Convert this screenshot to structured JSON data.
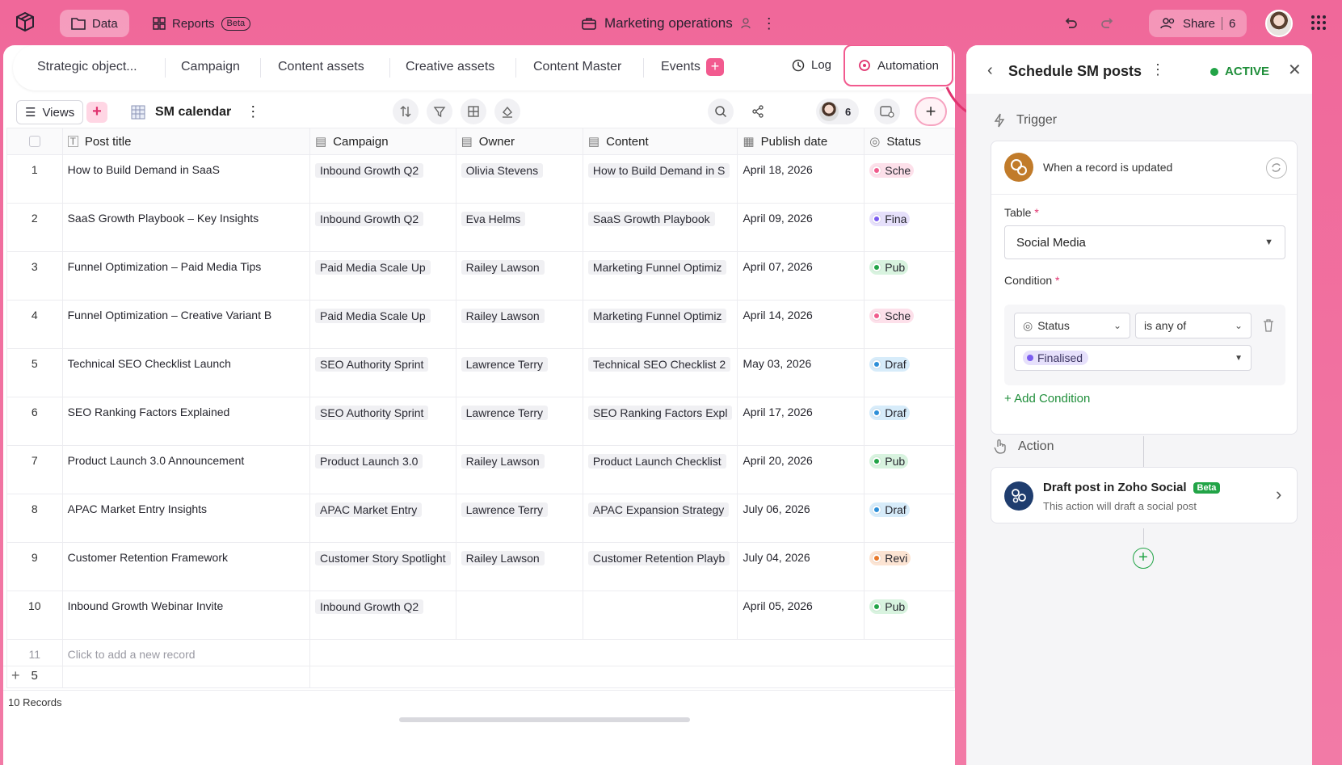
{
  "topbar": {
    "data_label": "Data",
    "reports_label": "Reports",
    "reports_badge": "Beta",
    "workspace_title": "Marketing operations",
    "share_label": "Share",
    "share_count": "6"
  },
  "tabs": {
    "items": [
      "Strategic object...",
      "Campaign",
      "Content assets",
      "Creative assets",
      "Content Master",
      "Events"
    ],
    "log_label": "Log",
    "automation_label": "Automation"
  },
  "toolbar": {
    "views_label": "Views",
    "view_name": "SM calendar",
    "collaborators_count": "6"
  },
  "table": {
    "headers": {
      "post_title": "Post title",
      "campaign": "Campaign",
      "owner": "Owner",
      "content": "Content",
      "publish_date": "Publish date",
      "status": "Status"
    },
    "rows": [
      {
        "num": "1",
        "title": "How to Build Demand in SaaS",
        "campaign": "Inbound Growth Q2",
        "owner": "Olivia Stevens",
        "content": "How to Build Demand in S",
        "date": "April 18, 2026",
        "status": "Sche",
        "status_color": "#f05b8c",
        "status_bg": "#fde0ea"
      },
      {
        "num": "2",
        "title": "SaaS Growth Playbook – Key Insights",
        "campaign": "Inbound Growth Q2",
        "owner": "Eva Helms",
        "content": "SaaS Growth Playbook",
        "date": "April 09, 2026",
        "status": "Fina",
        "status_color": "#7b5cf0",
        "status_bg": "#e6e0fb"
      },
      {
        "num": "3",
        "title": "Funnel Optimization – Paid Media Tips",
        "campaign": "Paid Media Scale Up",
        "owner": "Railey Lawson",
        "content": "Marketing Funnel Optimiz",
        "date": "April 07, 2026",
        "status": "Pub",
        "status_color": "#22a447",
        "status_bg": "#d8f3df"
      },
      {
        "num": "4",
        "title": "Funnel Optimization – Creative Variant B",
        "campaign": "Paid Media Scale Up",
        "owner": "Railey Lawson",
        "content": "Marketing Funnel Optimiz",
        "date": "April 14, 2026",
        "status": "Sche",
        "status_color": "#f05b8c",
        "status_bg": "#fde0ea"
      },
      {
        "num": "5",
        "title": "Technical SEO Checklist Launch",
        "campaign": "SEO Authority Sprint",
        "owner": "Lawrence Terry",
        "content": "Technical SEO Checklist 2",
        "date": "May 03, 2026",
        "status": "Draf",
        "status_color": "#2d8fd8",
        "status_bg": "#d7ecfa"
      },
      {
        "num": "6",
        "title": "SEO Ranking Factors Explained",
        "campaign": "SEO Authority Sprint",
        "owner": "Lawrence Terry",
        "content": "SEO Ranking Factors Expl",
        "date": "April 17, 2026",
        "status": "Draf",
        "status_color": "#2d8fd8",
        "status_bg": "#d7ecfa"
      },
      {
        "num": "7",
        "title": "Product Launch 3.0 Announcement",
        "campaign": "Product Launch 3.0",
        "owner": "Railey Lawson",
        "content": "Product Launch Checklist",
        "date": "April 20, 2026",
        "status": "Pub",
        "status_color": "#22a447",
        "status_bg": "#d8f3df"
      },
      {
        "num": "8",
        "title": "APAC Market Entry Insights",
        "campaign": "APAC Market Entry",
        "owner": "Lawrence Terry",
        "content": "APAC Expansion Strategy",
        "date": "July 06, 2026",
        "status": "Draf",
        "status_color": "#2d8fd8",
        "status_bg": "#d7ecfa"
      },
      {
        "num": "9",
        "title": "Customer Retention Framework",
        "campaign": "Customer Story Spotlight",
        "owner": "Railey Lawson",
        "content": "Customer Retention Playb",
        "date": "July 04, 2026",
        "status": "Revi",
        "status_color": "#e8782a",
        "status_bg": "#fce4d3"
      },
      {
        "num": "10",
        "title": "Inbound Growth Webinar Invite",
        "campaign": "Inbound Growth Q2",
        "owner": "",
        "content": "",
        "date": "April 05, 2026",
        "status": "Pub",
        "status_color": "#22a447",
        "status_bg": "#d8f3df"
      }
    ],
    "new_row_num": "11",
    "new_row_label": "Click to add a new record"
  },
  "footer": {
    "add_count": "5",
    "records_label": "10 Records"
  },
  "automation": {
    "title": "Schedule SM posts",
    "state": "ACTIVE",
    "trigger_label": "Trigger",
    "trigger_event": "When a record is updated",
    "table_label": "Table",
    "table_value": "Social Media",
    "condition_label": "Condition",
    "condition_field": "Status",
    "condition_operator": "is any of",
    "condition_value": "Finalised",
    "add_condition": "+ Add Condition",
    "action_label": "Action",
    "action_title": "Draft post in Zoho Social",
    "action_badge": "Beta",
    "action_desc": "This action will draft a social post"
  },
  "colors": {
    "accent_pink": "#f25a8f",
    "active_green": "#22a447"
  }
}
